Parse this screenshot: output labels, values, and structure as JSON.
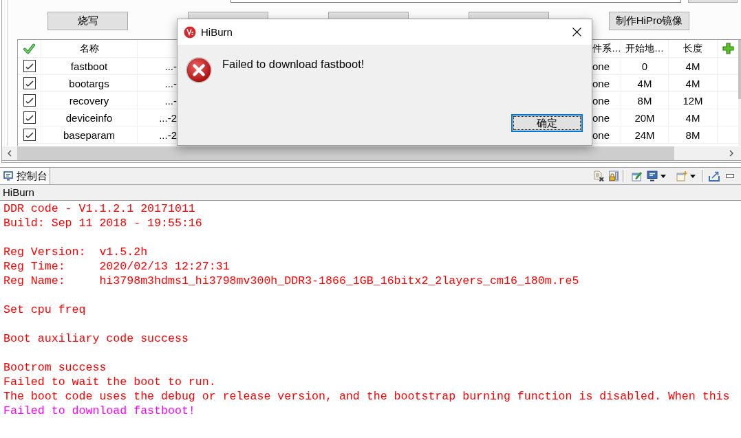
{
  "toolbar_buttons": [
    {
      "kind": "labeled",
      "label": "烧写"
    },
    {
      "kind": "covered"
    },
    {
      "kind": "covered"
    },
    {
      "kind": "covered"
    },
    {
      "kind": "labeled",
      "label": "制作HiPro镜像"
    }
  ],
  "table": {
    "columns": [
      "名称",
      "件系…",
      "开始地…",
      "长度"
    ],
    "rows": [
      {
        "checked": true,
        "name": "fastboot",
        "column_3": "...-",
        "column_4": "one",
        "start": "0",
        "length": "4M"
      },
      {
        "checked": true,
        "name": "bootargs",
        "column_3": "...-",
        "column_4": "one",
        "start": "4M",
        "length": "4M"
      },
      {
        "checked": true,
        "name": "recovery",
        "column_3": "...-",
        "column_4": "one",
        "start": "8M",
        "length": "12M"
      },
      {
        "checked": true,
        "name": "deviceinfo",
        "column_3": "...-2",
        "column_4": "one",
        "start": "20M",
        "length": "4M"
      },
      {
        "checked": true,
        "name": "baseparam",
        "column_3": "...-2",
        "column_4": "one",
        "start": "24M",
        "length": "8M"
      }
    ]
  },
  "console": {
    "tab": {
      "label": "控制台",
      "selected": true
    },
    "title": "HiBurn",
    "paragraphs": [
      [
        {
          "text": "DDR code - V1.1.2.1 20171011",
          "color": "#ff0000"
        },
        {
          "text": "Build: Sep 11 2018 - 19:55:16",
          "color": "#ff0000"
        }
      ],
      [
        {
          "text": "Reg Version:  v1.5.2h",
          "color": "#ff0000"
        },
        {
          "text": "Reg Time:     2020/02/13 12:27:31",
          "color": "#ff0000"
        },
        {
          "text": "Reg Name:     hi3798m3hdms1_hi3798mv300h_DDR3-1866_1GB_16bitx2_2layers_cm16_180m.re5",
          "color": "#ff0000"
        }
      ],
      [
        {
          "text": "Set cpu freq",
          "color": "#ff0000"
        }
      ],
      [
        {
          "text": "Boot auxiliary code success",
          "color": "#ff0000"
        }
      ],
      [
        {
          "text": "Bootrom success",
          "color": "#ff0000"
        },
        {
          "text": "Failed to wait the boot to run.",
          "color": "#ff0000"
        },
        {
          "text": "The boot code uses the debug or release version, and the bootstrap burning function is disabled. When this",
          "color": "#ff0000"
        },
        {
          "text": "Failed to download fastboot!",
          "color": "#ff00ff"
        }
      ]
    ]
  },
  "dialog": {
    "title": "HiBurn",
    "message": "Failed to download fastboot!",
    "button": "确定"
  }
}
